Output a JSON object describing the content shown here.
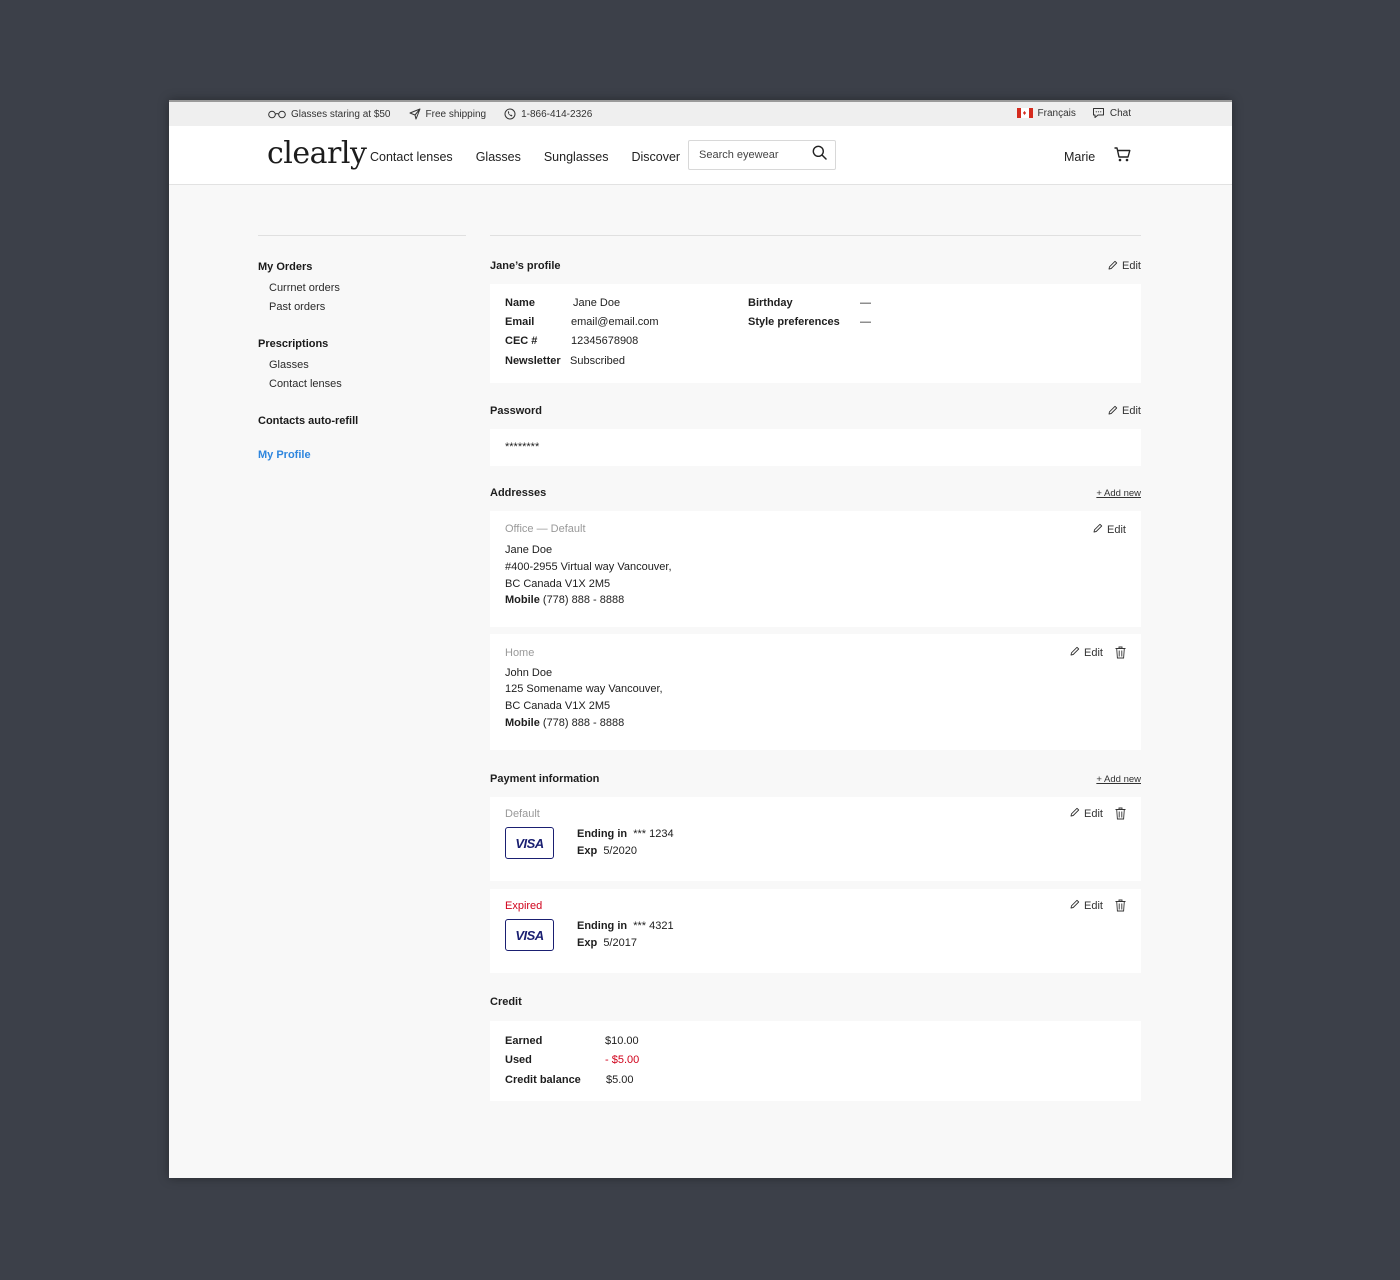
{
  "promo": {
    "glasses_offer": "Glasses staring at $50",
    "shipping": "Free shipping",
    "phone": "1-866-414-2326",
    "language": "Français",
    "chat": "Chat"
  },
  "header": {
    "logo": "clearly",
    "nav": [
      "Contact lenses",
      "Glasses",
      "Sunglasses",
      "Discover"
    ],
    "search_placeholder": "Search eyewear",
    "user": "Marie"
  },
  "sidebar": {
    "groups": [
      {
        "title": "My Orders",
        "items": [
          "Currnet orders",
          "Past orders"
        ]
      },
      {
        "title": "Prescriptions",
        "items": [
          "Glasses",
          "Contact lenses"
        ]
      },
      {
        "title": "Contacts auto-refill",
        "items": []
      }
    ],
    "active": "My Profile"
  },
  "profile": {
    "title": "Jane’s profile",
    "edit": "Edit",
    "fields_left": [
      {
        "label": "Name",
        "value": "Jane Doe"
      },
      {
        "label": "Email",
        "value": "email@email.com"
      },
      {
        "label": "CEC #",
        "value": "12345678908"
      },
      {
        "label": "Newsletter",
        "value": "Subscribed"
      }
    ],
    "fields_right": [
      {
        "label": "Birthday",
        "value": "—"
      },
      {
        "label": "Style preferences",
        "value": "—"
      }
    ]
  },
  "password": {
    "title": "Password",
    "edit": "Edit",
    "value": "********"
  },
  "addresses": {
    "title": "Addresses",
    "add_new": "+ Add new",
    "items": [
      {
        "tag": "Office — Default",
        "name": "Jane Doe",
        "line1": "#400-2955 Virtual way Vancouver,",
        "line2": "BC Canada V1X 2M5",
        "phone_label": "Mobile",
        "phone": "(778) 888 - 8888",
        "edit": "Edit"
      },
      {
        "tag": "Home",
        "name": "John Doe",
        "line1": "125 Somename way Vancouver,",
        "line2": "BC Canada V1X 2M5",
        "phone_label": "Mobile",
        "phone": "(778) 888 - 8888",
        "edit": "Edit"
      }
    ]
  },
  "payment": {
    "title": "Payment information",
    "add_new": "+ Add new",
    "cards": [
      {
        "status": "Default",
        "brand": "VISA",
        "ending_label": "Ending in",
        "ending": "*** 1234",
        "exp_label": "Exp",
        "exp": "5/2020",
        "edit": "Edit"
      },
      {
        "status": "Expired",
        "brand": "VISA",
        "ending_label": "Ending in",
        "ending": "*** 4321",
        "exp_label": "Exp",
        "exp": "5/2017",
        "edit": "Edit"
      }
    ]
  },
  "credit": {
    "title": "Credit",
    "rows": [
      {
        "label": "Earned",
        "value": "$10.00"
      },
      {
        "label": "Used",
        "value": "- $5.00"
      },
      {
        "label": "Credit balance",
        "value": "$5.00"
      }
    ]
  },
  "colors": {
    "accent": "#2e86de",
    "error": "#d0021b",
    "visa": "#1a1f71",
    "background": "#3c4049"
  }
}
